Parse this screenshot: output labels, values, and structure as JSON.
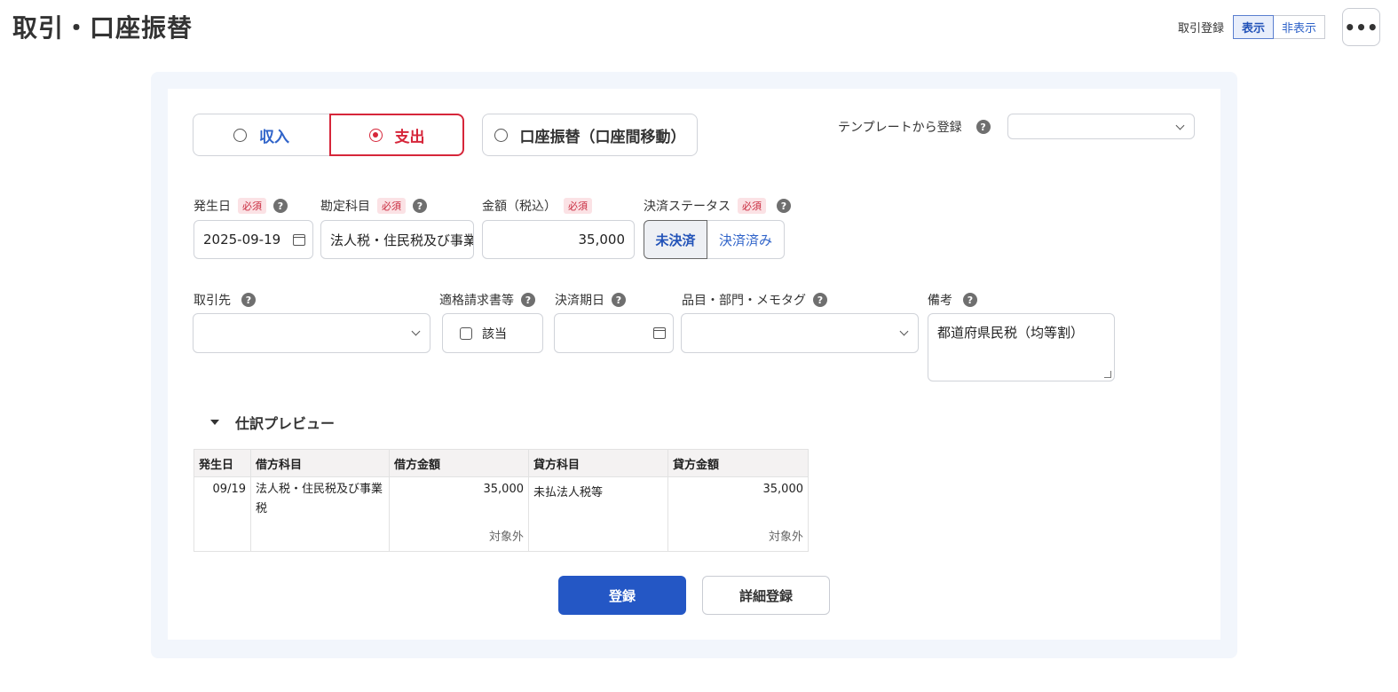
{
  "page": {
    "title": "取引・口座振替"
  },
  "header": {
    "register_label": "取引登録",
    "show_label": "表示",
    "hide_label": "非表示",
    "more_label": "•••"
  },
  "form": {
    "type_tabs": {
      "income": "収入",
      "expense": "支出",
      "transfer": "口座振替（口座間移動）",
      "selected": "expense"
    },
    "template": {
      "label": "テンプレートから登録",
      "value": ""
    },
    "required_badge": "必須",
    "help_glyph": "?",
    "date": {
      "label": "発生日",
      "value": "2025-09-19"
    },
    "account": {
      "label": "勘定科目",
      "value": "法人税・住民税及び事業税"
    },
    "amount": {
      "label": "金額（税込）",
      "value": "35,000"
    },
    "status": {
      "label": "決済ステータス",
      "unpaid": "未決済",
      "paid": "決済済み",
      "selected": "unpaid"
    },
    "partner": {
      "label": "取引先",
      "value": ""
    },
    "invoice": {
      "label": "適格請求書等",
      "checkbox_label": "該当",
      "checked": false
    },
    "due_date": {
      "label": "決済期日",
      "value": ""
    },
    "tags": {
      "label": "品目・部門・メモタグ",
      "value": ""
    },
    "memo": {
      "label": "備考",
      "value": "都道府県民税（均等割）"
    }
  },
  "preview": {
    "title": "仕訳プレビュー",
    "columns": [
      "発生日",
      "借方科目",
      "借方金額",
      "貸方科目",
      "貸方金額"
    ],
    "row": {
      "date": "09/19",
      "debit_account": "法人税・住民税及び事業税",
      "debit_amount": "35,000",
      "debit_tax": "対象外",
      "credit_account": "未払法人税等",
      "credit_amount": "35,000",
      "credit_tax": "対象外"
    }
  },
  "buttons": {
    "register": "登録",
    "detail_register": "詳細登録"
  },
  "colors": {
    "primary": "#2457c5",
    "expense_red": "#d6263a",
    "link_blue": "#2f63c9",
    "panel_bg": "#f2f6fc"
  }
}
